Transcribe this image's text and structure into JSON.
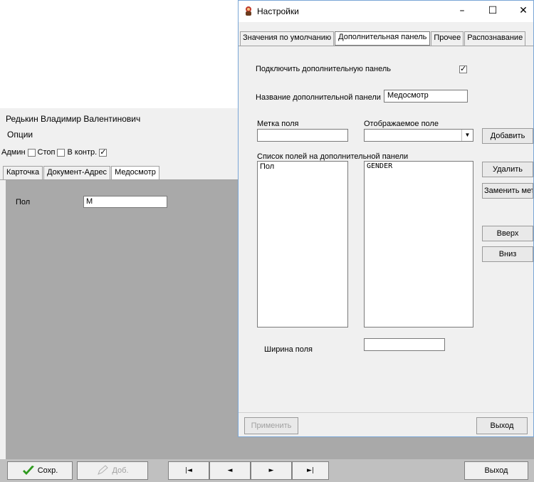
{
  "main_window": {
    "title": "Редькин Владимир Валентинович",
    "menu": "Опции",
    "options": [
      {
        "label": "Админ",
        "checked": false
      },
      {
        "label": "Стоп",
        "checked": false
      },
      {
        "label": "В контр.",
        "checked": true
      }
    ],
    "tabs": [
      "Карточка",
      "Документ-Адрес",
      "Медосмотр"
    ],
    "active_tab": "Медосмотр",
    "field_label": "Пол",
    "field_value": "М",
    "buttons": {
      "save": "Сохр.",
      "add": "Доб.",
      "first": "|◄",
      "prev": "◄",
      "next": "►",
      "last": "►|",
      "exit": "Выход"
    }
  },
  "dialog": {
    "title": "Настройки",
    "tabs": [
      "Значения по умолчанию",
      "Дополнительная панель",
      "Прочее",
      "Распознавание"
    ],
    "active_tab": "Дополнительная панель",
    "enable_label": "Подключить дополнительную панель",
    "enable_checked": true,
    "panel_name_label": "Название дополнительной панели",
    "panel_name_value": "Медосмотр",
    "field_label_caption": "Метка поля",
    "field_label_value": "",
    "display_field_caption": "Отображаемое поле",
    "display_field_value": "",
    "add_button": "Добавить",
    "list_caption": "Список полей на дополнительной панели",
    "list_labels": [
      "Пол"
    ],
    "list_fields": [
      "GENDER"
    ],
    "delete_button": "Удалить",
    "replace_button": "Заменить метку",
    "up_button": "Вверх",
    "down_button": "Вниз",
    "width_label": "Ширина поля",
    "width_value": "",
    "apply_button": "Применить",
    "exit_button": "Выход"
  },
  "colors": {
    "panel_gray": "#a9a9a9",
    "window_bg": "#f0f0f0",
    "check_green": "#2e9a1e"
  }
}
